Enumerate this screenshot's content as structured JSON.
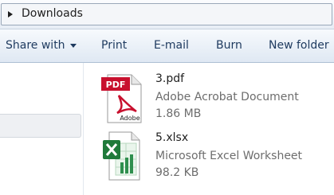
{
  "address_bar": {
    "path": "Downloads"
  },
  "toolbar": {
    "share_with": "Share with",
    "print": "Print",
    "email": "E-mail",
    "burn": "Burn",
    "new_folder": "New folder"
  },
  "files": [
    {
      "name": "3.pdf",
      "type": "Adobe Acrobat Document",
      "size": "1.86 MB",
      "icon": "pdf-icon",
      "icon_label": "PDF",
      "icon_brand": "Adobe"
    },
    {
      "name": "5.xlsx",
      "type": "Microsoft Excel Worksheet",
      "size": "98.2 KB",
      "icon": "excel-icon"
    }
  ],
  "colors": {
    "toolbar_text": "#1e3a5f",
    "pdf_red": "#c8102e",
    "excel_green": "#1f7a3a",
    "secondary_text": "#6d6d6d"
  }
}
